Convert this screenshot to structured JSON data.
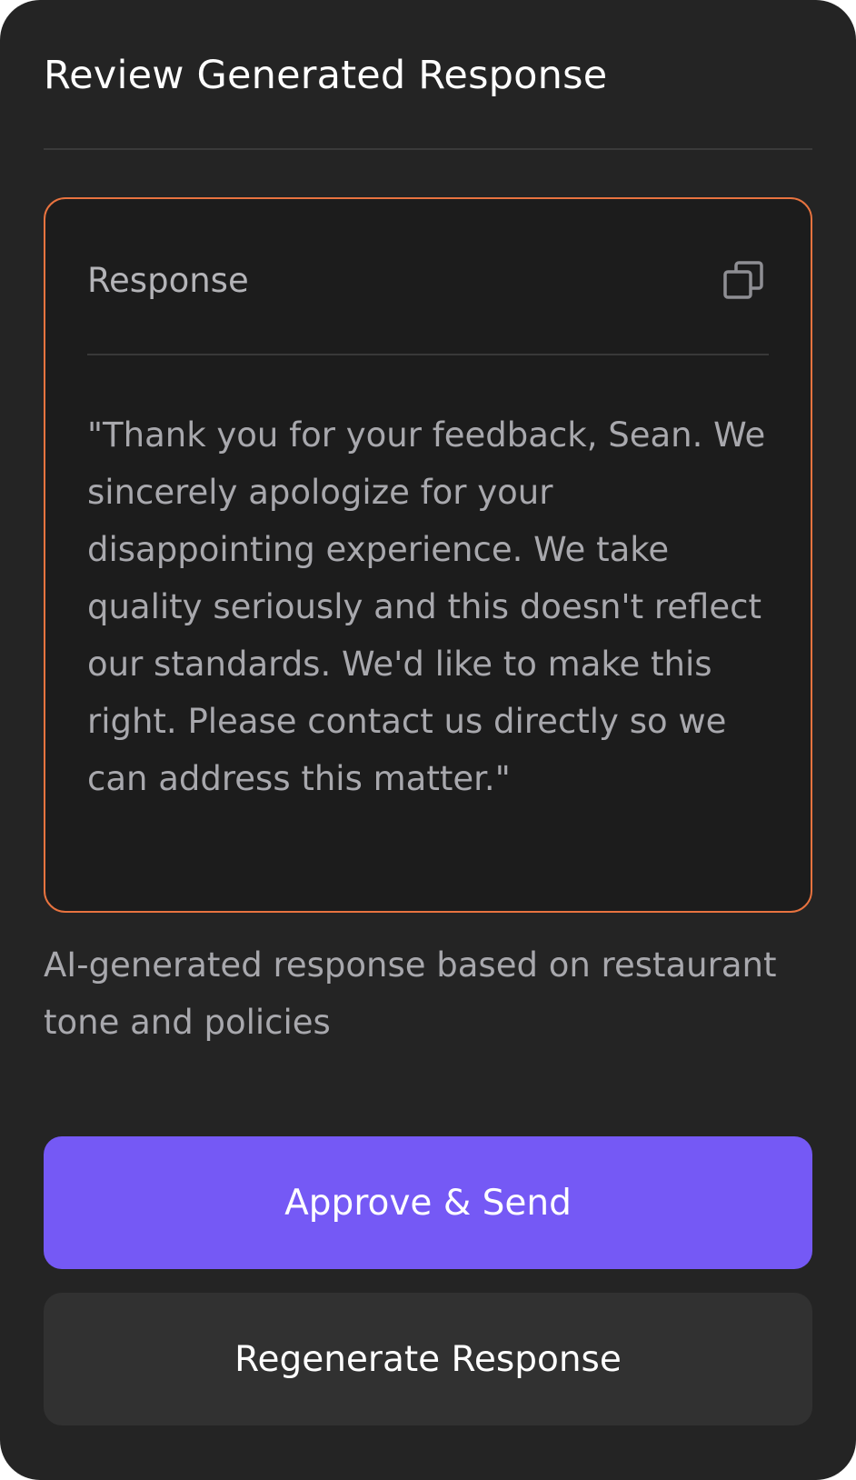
{
  "header": {
    "title": "Review Generated Response"
  },
  "response": {
    "label": "Response",
    "copy_icon": "copy-icon",
    "text": "\"Thank you for your feedback, Sean. We sincerely apologize for your disappointing experience. We take quality seriously and this doesn't reflect our standards. We'd like to make this right. Please contact us directly so we can address this matter.\""
  },
  "note": "AI-generated response based on restaurant tone and policies",
  "actions": {
    "approve_label": "Approve & Send",
    "regenerate_label": "Regenerate Response"
  },
  "colors": {
    "card_background": "#242424",
    "response_border": "#e8733f",
    "primary_button": "#7559f5",
    "secondary_button": "#313131"
  }
}
